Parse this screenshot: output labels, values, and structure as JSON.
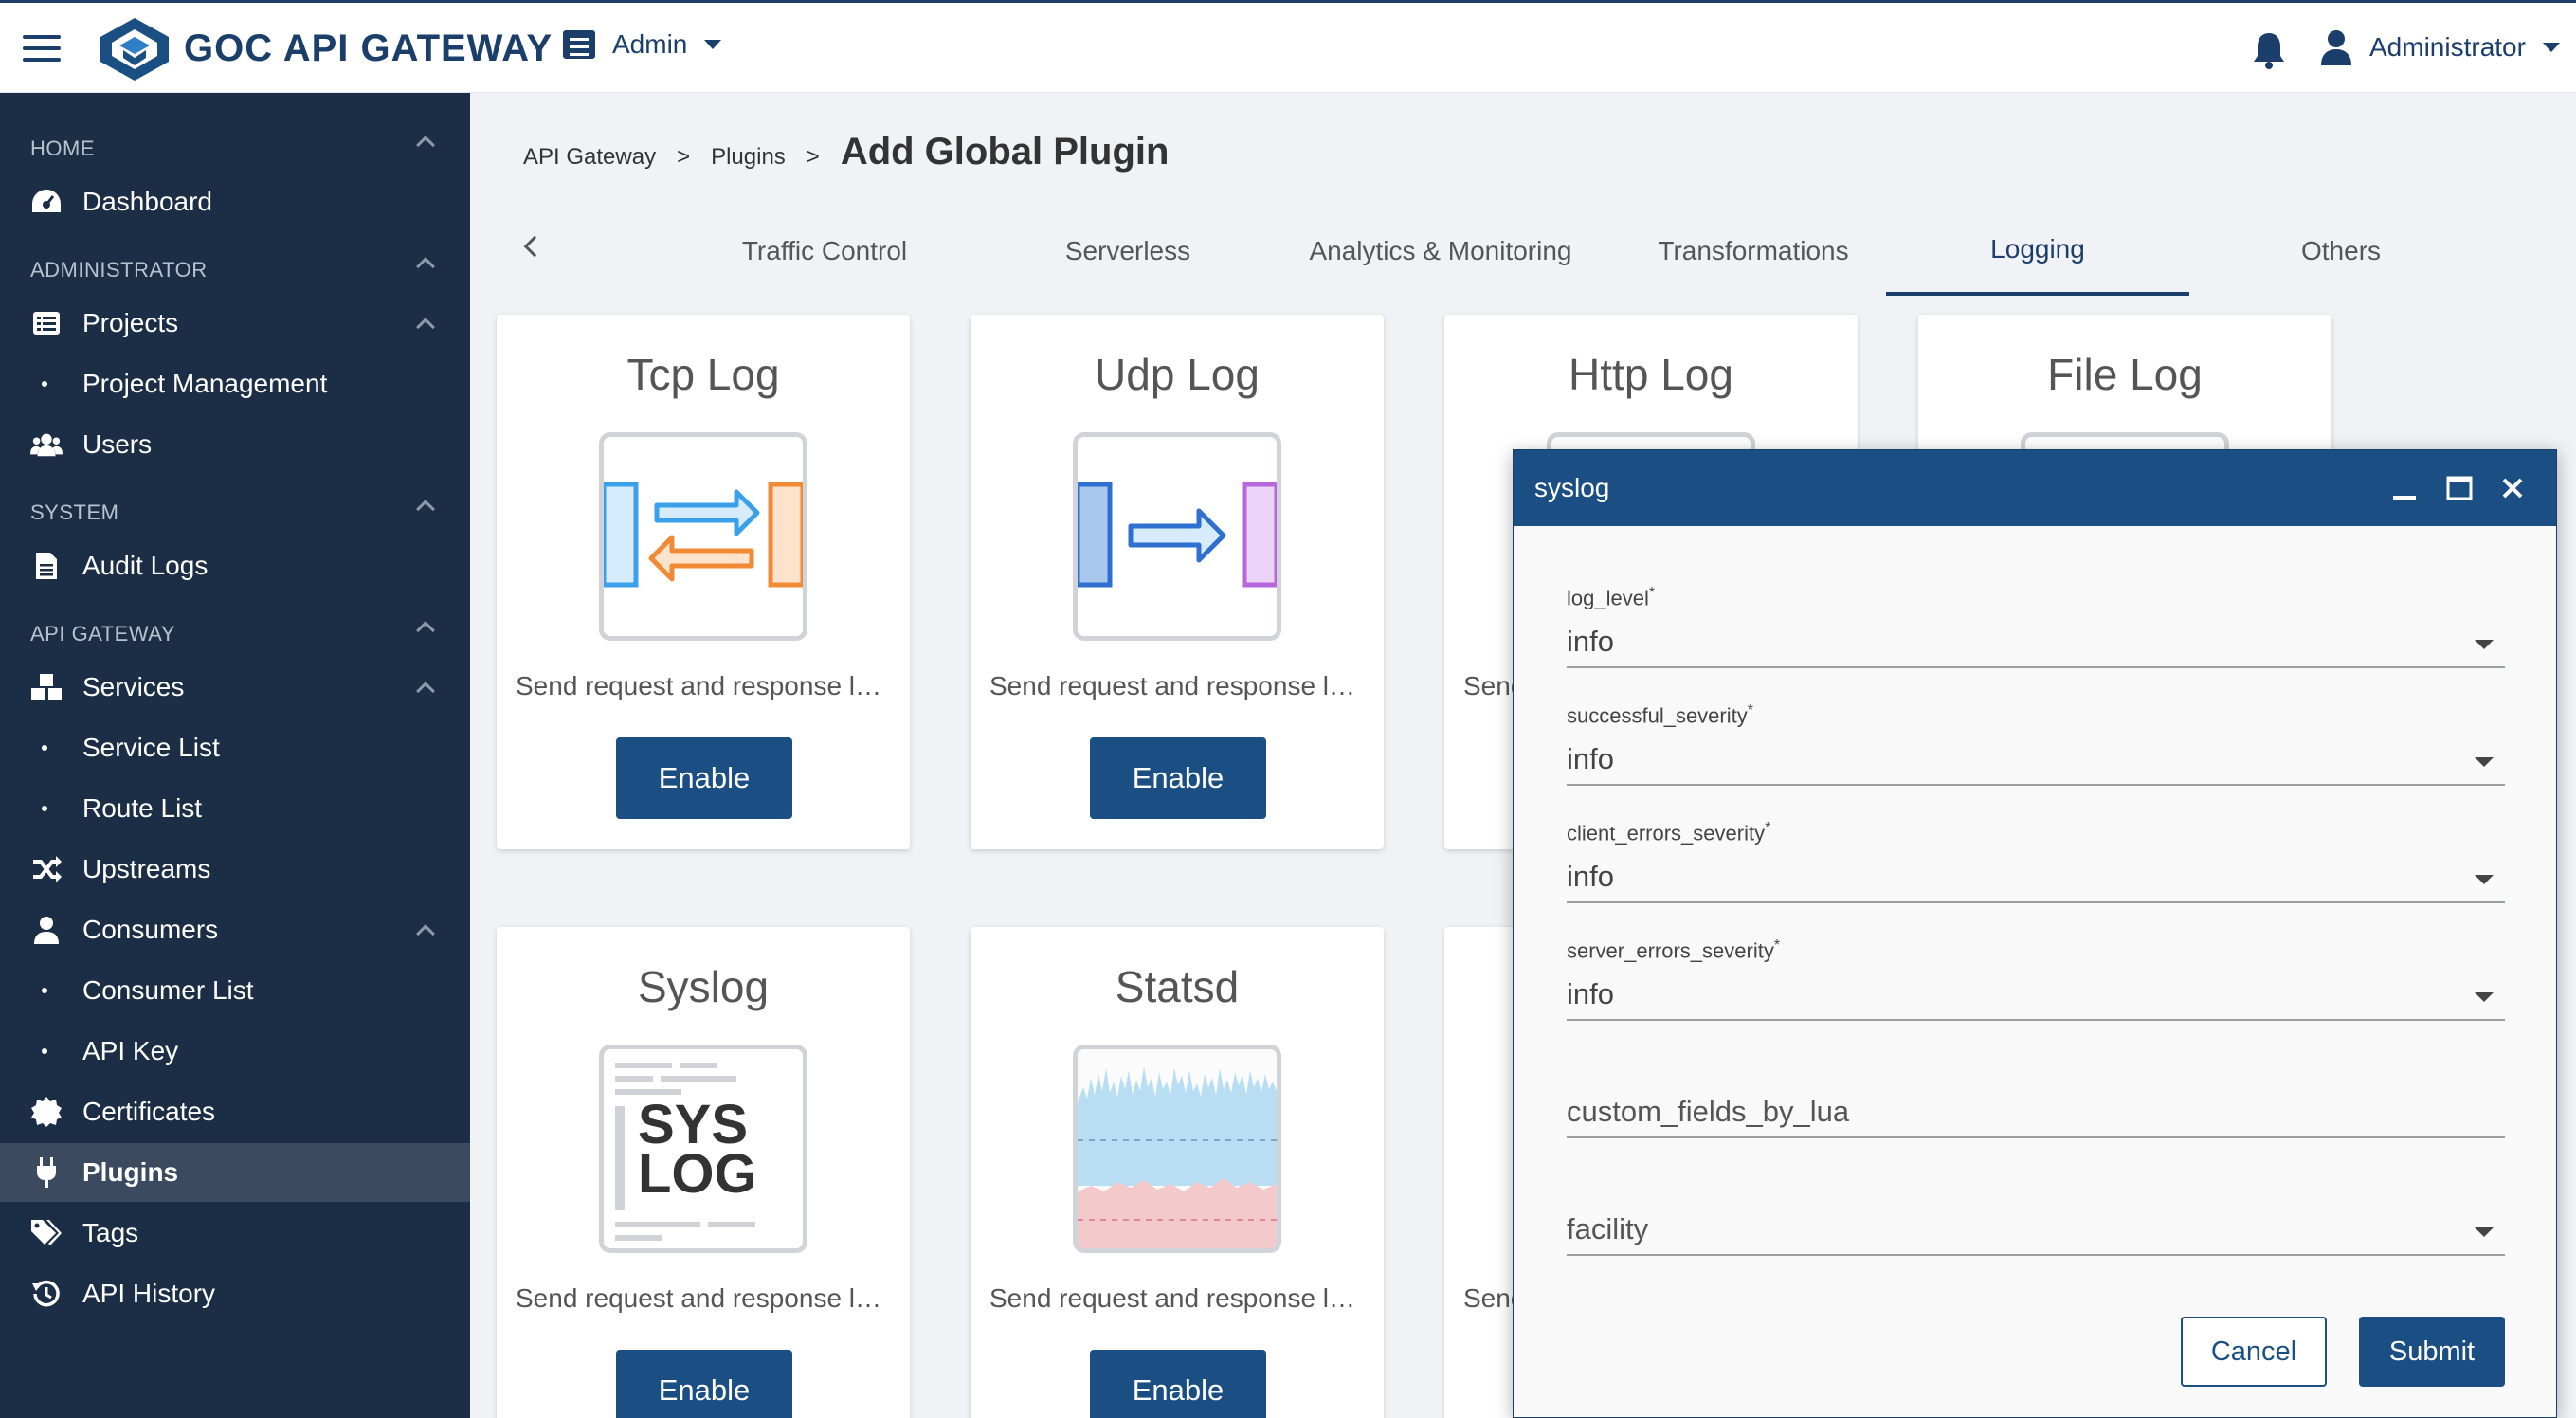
{
  "header": {
    "title": "GOC API GATEWAY",
    "role_menu": "Admin",
    "user": "Administrator"
  },
  "sidebar": {
    "sections": {
      "home": "HOME",
      "administrator": "ADMINISTRATOR",
      "system": "SYSTEM",
      "api_gateway": "API GATEWAY"
    },
    "items": {
      "dashboard": "Dashboard",
      "projects": "Projects",
      "project_management": "Project Management",
      "users": "Users",
      "audit_logs": "Audit Logs",
      "services": "Services",
      "service_list": "Service List",
      "route_list": "Route List",
      "upstreams": "Upstreams",
      "consumers": "Consumers",
      "consumer_list": "Consumer List",
      "api_key": "API Key",
      "certificates": "Certificates",
      "plugins": "Plugins",
      "tags": "Tags",
      "api_history": "API History"
    },
    "active": "Plugins"
  },
  "breadcrumb": {
    "level1": "API Gateway",
    "sep": ">",
    "level2": "Plugins",
    "current": "Add Global Plugin"
  },
  "tabs": {
    "traffic_control": "Traffic Control",
    "serverless": "Serverless",
    "analytics": "Analytics & Monitoring",
    "transformations": "Transformations",
    "logging": "Logging",
    "others": "Others",
    "active": "Logging"
  },
  "cards": {
    "tcp": {
      "title": "Tcp Log",
      "desc": "Send request and response logs",
      "button": "Enable"
    },
    "udp": {
      "title": "Udp Log",
      "desc": "Send request and response logs",
      "button": "Enable"
    },
    "http": {
      "title": "Http Log",
      "desc": "Send"
    },
    "file": {
      "title": "File Log"
    },
    "syslog": {
      "title": "Syslog",
      "desc": "Send request and response logs",
      "button": "Enable",
      "logo_top": "SYS",
      "logo_bottom": "LOG"
    },
    "statsd": {
      "title": "Statsd",
      "desc": "Send request and response logs",
      "button": "Enable"
    },
    "third": {
      "desc": "Send"
    }
  },
  "modal": {
    "title": "syslog",
    "fields": {
      "log_level": {
        "label": "log_level",
        "value": "info"
      },
      "successful_severity": {
        "label": "successful_severity",
        "value": "info"
      },
      "client_errors_severity": {
        "label": "client_errors_severity",
        "value": "info"
      },
      "server_errors_severity": {
        "label": "server_errors_severity",
        "value": "info"
      },
      "custom_fields_by_lua": {
        "placeholder": "custom_fields_by_lua"
      },
      "facility": {
        "placeholder": "facility"
      }
    },
    "required_mark": "*",
    "cancel": "Cancel",
    "submit": "Submit"
  },
  "colors": {
    "primary": "#1b4f84",
    "sidebar": "#1c2e45",
    "active_nav": "#3b4a5e"
  }
}
